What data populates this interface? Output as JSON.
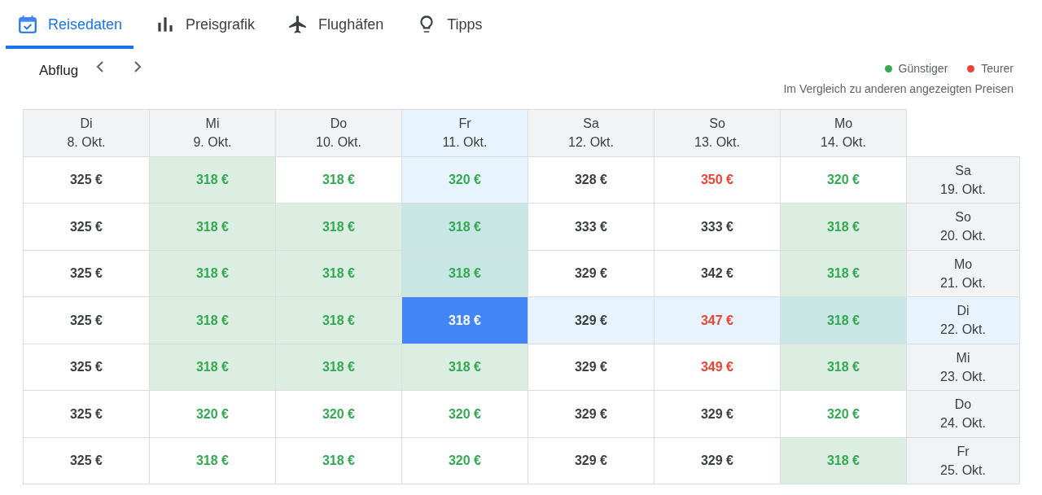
{
  "tabs": [
    {
      "label": "Reisedaten",
      "selected": true
    },
    {
      "label": "Preisgrafik",
      "selected": false
    },
    {
      "label": "Flughäfen",
      "selected": false
    },
    {
      "label": "Tipps",
      "selected": false
    }
  ],
  "navigator": {
    "label": "Abflug"
  },
  "legend": [
    {
      "label": "Günstiger",
      "color": "#34a853"
    },
    {
      "label": "Teurer",
      "color": "#ea4335"
    }
  ],
  "legend_note": "Im Vergleich zu anderen angezeigten Preisen",
  "grid": {
    "columns": [
      {
        "day": "Di",
        "date": "8. Okt."
      },
      {
        "day": "Mi",
        "date": "9. Okt."
      },
      {
        "day": "Do",
        "date": "10. Okt."
      },
      {
        "day": "Fr",
        "date": "11. Okt."
      },
      {
        "day": "Sa",
        "date": "12. Okt."
      },
      {
        "day": "So",
        "date": "13. Okt."
      },
      {
        "day": "Mo",
        "date": "14. Okt."
      }
    ],
    "rows": [
      {
        "day": "Sa",
        "date": "19. Okt.",
        "cells": [
          {
            "price": "325 €",
            "color": "#3c4043",
            "lowest": false,
            "selected": false
          },
          {
            "price": "318 €",
            "color": "#34a853",
            "lowest": true,
            "selected": false
          },
          {
            "price": "318 €",
            "color": "#34a853",
            "lowest": false,
            "selected": false
          },
          {
            "price": "320 €",
            "color": "#34a853",
            "lowest": false,
            "selected": false
          },
          {
            "price": "328 €",
            "color": "#3c4043",
            "lowest": false,
            "selected": false
          },
          {
            "price": "350 €",
            "color": "#ea4335",
            "lowest": false,
            "selected": false
          },
          {
            "price": "320 €",
            "color": "#34a853",
            "lowest": false,
            "selected": false
          }
        ]
      },
      {
        "day": "So",
        "date": "20. Okt.",
        "cells": [
          {
            "price": "325 €",
            "color": "#3c4043",
            "lowest": false,
            "selected": false
          },
          {
            "price": "318 €",
            "color": "#34a853",
            "lowest": true,
            "selected": false
          },
          {
            "price": "318 €",
            "color": "#34a853",
            "lowest": true,
            "selected": false
          },
          {
            "price": "318 €",
            "color": "#34a853",
            "lowest": true,
            "selected": false
          },
          {
            "price": "333 €",
            "color": "#3c4043",
            "lowest": false,
            "selected": false
          },
          {
            "price": "333 €",
            "color": "#3c4043",
            "lowest": false,
            "selected": false
          },
          {
            "price": "318 €",
            "color": "#34a853",
            "lowest": true,
            "selected": false
          }
        ]
      },
      {
        "day": "Mo",
        "date": "21. Okt.",
        "cells": [
          {
            "price": "325 €",
            "color": "#3c4043",
            "lowest": false,
            "selected": false
          },
          {
            "price": "318 €",
            "color": "#34a853",
            "lowest": true,
            "selected": false
          },
          {
            "price": "318 €",
            "color": "#34a853",
            "lowest": true,
            "selected": false
          },
          {
            "price": "318 €",
            "color": "#34a853",
            "lowest": true,
            "selected": false
          },
          {
            "price": "329 €",
            "color": "#3c4043",
            "lowest": false,
            "selected": false
          },
          {
            "price": "342 €",
            "color": "#3c4043",
            "lowest": false,
            "selected": false
          },
          {
            "price": "318 €",
            "color": "#34a853",
            "lowest": true,
            "selected": false
          }
        ]
      },
      {
        "day": "Di",
        "date": "22. Okt.",
        "cells": [
          {
            "price": "325 €",
            "color": "#3c4043",
            "lowest": false,
            "selected": false
          },
          {
            "price": "318 €",
            "color": "#34a853",
            "lowest": true,
            "selected": false
          },
          {
            "price": "318 €",
            "color": "#34a853",
            "lowest": true,
            "selected": false
          },
          {
            "price": "318 €",
            "color": "#ffffff",
            "lowest": true,
            "selected": true
          },
          {
            "price": "329 €",
            "color": "#3c4043",
            "lowest": false,
            "selected": false
          },
          {
            "price": "347 €",
            "color": "#ea4335",
            "lowest": false,
            "selected": false
          },
          {
            "price": "318 €",
            "color": "#34a853",
            "lowest": true,
            "selected": false
          }
        ]
      },
      {
        "day": "Mi",
        "date": "23. Okt.",
        "cells": [
          {
            "price": "325 €",
            "color": "#3c4043",
            "lowest": false,
            "selected": false
          },
          {
            "price": "318 €",
            "color": "#34a853",
            "lowest": true,
            "selected": false
          },
          {
            "price": "318 €",
            "color": "#34a853",
            "lowest": true,
            "selected": false
          },
          {
            "price": "318 €",
            "color": "#34a853",
            "lowest": true,
            "selected": false
          },
          {
            "price": "329 €",
            "color": "#3c4043",
            "lowest": false,
            "selected": false
          },
          {
            "price": "349 €",
            "color": "#ea4335",
            "lowest": false,
            "selected": false
          },
          {
            "price": "318 €",
            "color": "#34a853",
            "lowest": true,
            "selected": false
          }
        ]
      },
      {
        "day": "Do",
        "date": "24. Okt.",
        "cells": [
          {
            "price": "325 €",
            "color": "#3c4043",
            "lowest": false,
            "selected": false
          },
          {
            "price": "320 €",
            "color": "#34a853",
            "lowest": false,
            "selected": false
          },
          {
            "price": "320 €",
            "color": "#34a853",
            "lowest": false,
            "selected": false
          },
          {
            "price": "320 €",
            "color": "#34a853",
            "lowest": false,
            "selected": false
          },
          {
            "price": "329 €",
            "color": "#3c4043",
            "lowest": false,
            "selected": false
          },
          {
            "price": "329 €",
            "color": "#3c4043",
            "lowest": false,
            "selected": false
          },
          {
            "price": "320 €",
            "color": "#34a853",
            "lowest": false,
            "selected": false
          }
        ]
      },
      {
        "day": "Fr",
        "date": "25. Okt.",
        "cells": [
          {
            "price": "325 €",
            "color": "#3c4043",
            "lowest": false,
            "selected": false
          },
          {
            "price": "318 €",
            "color": "#34a853",
            "lowest": false,
            "selected": false
          },
          {
            "price": "318 €",
            "color": "#34a853",
            "lowest": false,
            "selected": false
          },
          {
            "price": "320 €",
            "color": "#34a853",
            "lowest": false,
            "selected": false
          },
          {
            "price": "329 €",
            "color": "#3c4043",
            "lowest": false,
            "selected": false
          },
          {
            "price": "329 €",
            "color": "#3c4043",
            "lowest": false,
            "selected": false
          },
          {
            "price": "318 €",
            "color": "#34a853",
            "lowest": true,
            "selected": false
          }
        ]
      }
    ]
  }
}
